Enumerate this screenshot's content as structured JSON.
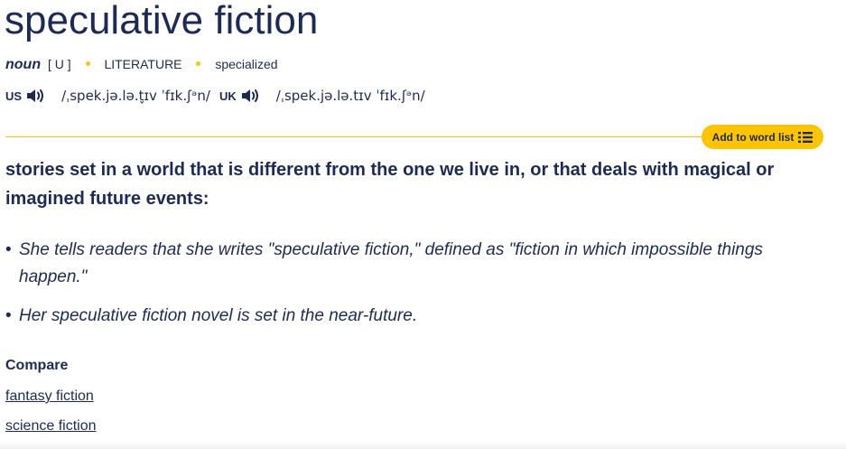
{
  "entry": {
    "headword": "speculative fiction",
    "part_of_speech": "noun",
    "grammar": "[ U ]",
    "domain_label": "LITERATURE",
    "register_label": "specialized"
  },
  "pronunciations": [
    {
      "region": "US",
      "ipa": "/ˌspek.jə.lə.t̬ɪv ˈfɪk.ʃᵊn/",
      "icon": "speaker-icon"
    },
    {
      "region": "UK",
      "ipa": "/ˌspek.jə.lə.tɪv ˈfɪk.ʃᵊn/",
      "icon": "speaker-icon"
    }
  ],
  "add_to_word_list": {
    "label": "Add to word list",
    "icon": "list-icon"
  },
  "definition": "stories set in a world that is different from the one we live in, or that deals with magical or imagined future events:",
  "examples": [
    "She tells readers that she writes \"speculative fiction,\" defined as \"fiction in which impossible things happen.\"",
    "Her speculative fiction novel is set in the near-future."
  ],
  "compare": {
    "title": "Compare",
    "links": [
      "fantasy fiction",
      "science fiction"
    ]
  },
  "colors": {
    "text": "#1d2a57",
    "accent": "#fec400",
    "background": "#ffffff"
  }
}
